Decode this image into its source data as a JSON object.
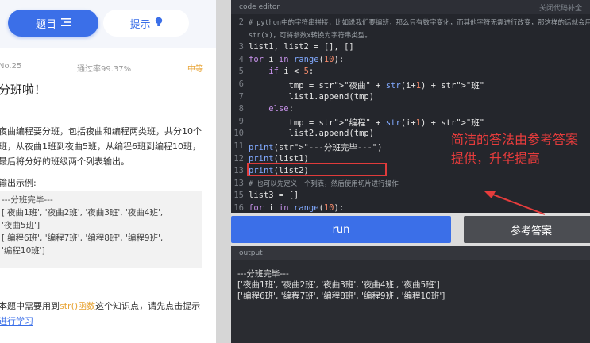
{
  "tabs": {
    "question": "题目",
    "hint": "提示"
  },
  "meta": {
    "number": "No.25",
    "pass_rate": "通过率99.37%",
    "difficulty": "中等"
  },
  "problem": {
    "title": "分班啦！",
    "desc_lines": [
      "夜曲编程要分班，包括夜曲和编程两类班，共分10个",
      "班，从夜曲1班到夜曲5班，从编程6班到编程10班，",
      "最后将分好的班级两个列表输出。"
    ],
    "example_label": "输出示例:",
    "example_lines": [
      "---分班完毕---",
      "['夜曲1班', '夜曲2班', '夜曲3班', '夜曲4班',",
      " '夜曲5班']",
      "['编程6班', '编程7班', '编程8班', '编程9班',",
      " '编程10班']"
    ],
    "hint_pre": "本题中需要用到",
    "hint_hl": "str()函数",
    "hint_post": "这个知识点，请先点击提示",
    "hint_link": "进行学习"
  },
  "editor": {
    "title": "code editor",
    "right": "关闭代码补全",
    "lines": [
      {
        "n": "2",
        "t": "# python中的字符串拼接，比如说我们要编班，那么只有数字变化，而其他字符无需进行改变，那这样的话就会用到字符串拼接",
        "c": true
      },
      {
        "n": "",
        "t": "str(x)，可将参数x转换为字符串类型。",
        "c": true
      },
      {
        "n": "3",
        "t": "list1, list2 = [], []"
      },
      {
        "n": "4",
        "t": "for i in range(10):"
      },
      {
        "n": "5",
        "t": "    if i < 5:"
      },
      {
        "n": "6",
        "t": "        tmp = \"夜曲\" + str(i+1) + \"班\""
      },
      {
        "n": "7",
        "t": "        list1.append(tmp)"
      },
      {
        "n": "8",
        "t": "    else:"
      },
      {
        "n": "9",
        "t": "        tmp = \"编程\" + str(i+1) + \"班\""
      },
      {
        "n": "10",
        "t": "        list2.append(tmp)"
      },
      {
        "n": "11",
        "t": "print(\"---分班完毕---\")"
      },
      {
        "n": "12",
        "t": "print(list1)"
      },
      {
        "n": "13",
        "t": "print(list2)"
      },
      {
        "n": "13",
        "t": "# 也可以先定义一个列表，然后使用切片进行操作",
        "c": true
      },
      {
        "n": "15",
        "t": "list3 = []"
      },
      {
        "n": "16",
        "t": "for i in range(10):"
      },
      {
        "n": "17",
        "t": "    if i < 5:"
      }
    ]
  },
  "annotation": "简洁的答法由参考答案提供，升华提高",
  "buttons": {
    "run": "run",
    "reference": "参考答案"
  },
  "output": {
    "title": "output",
    "lines": [
      "---分班完毕---",
      "['夜曲1班', '夜曲2班', '夜曲3班', '夜曲4班', '夜曲5班']",
      "['编程6班', '编程7班', '编程8班', '编程9班', '编程10班']"
    ]
  },
  "colors": {
    "accent": "#3b6fe8",
    "annotation": "#e63c3c",
    "editor_bg": "#24262c"
  }
}
